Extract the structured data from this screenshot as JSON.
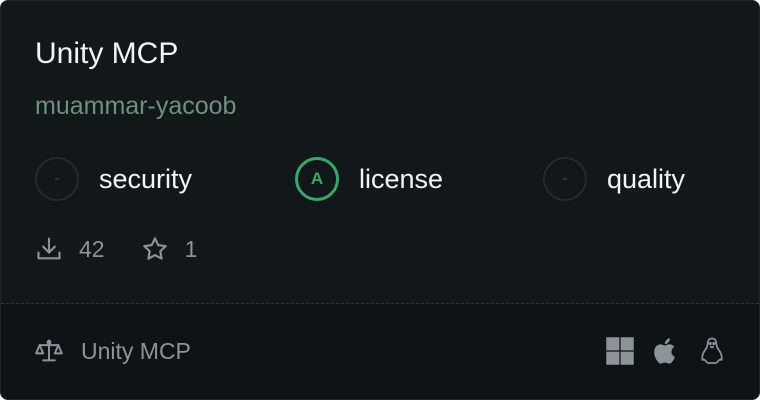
{
  "card": {
    "title": "Unity MCP",
    "author": "muammar-yacoob",
    "badges": [
      {
        "grade": "-",
        "label": "security",
        "graded": false
      },
      {
        "grade": "A",
        "label": "license",
        "graded": true,
        "color": "#3aa669"
      },
      {
        "grade": "-",
        "label": "quality",
        "graded": false
      }
    ],
    "stats": {
      "downloads": "42",
      "stars": "1"
    },
    "footer": {
      "license_name": "Unity MCP",
      "platforms": [
        "windows-icon",
        "apple-icon",
        "linux-icon"
      ]
    }
  }
}
